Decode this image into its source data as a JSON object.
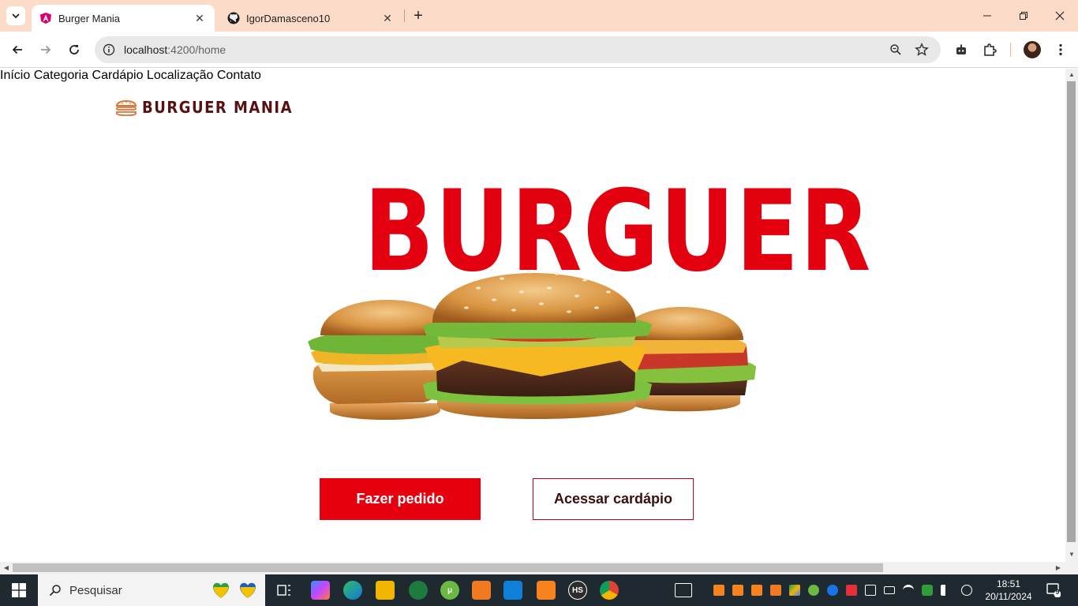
{
  "browser": {
    "tabs": [
      {
        "title": "Burger Mania",
        "active": true,
        "icon": "angular-icon"
      },
      {
        "title": "IgorDamasceno10",
        "active": false,
        "icon": "github-icon"
      }
    ],
    "url_host": "localhost",
    "url_path": ":4200/home"
  },
  "site": {
    "logo_text": "BURGUER MANIA",
    "nav": [
      "Início",
      "Categoria",
      "Cardápio",
      "Localização",
      "Contato"
    ],
    "hero_word": "BURGUER",
    "cta_primary": "Fazer pedido",
    "cta_secondary": "Acessar cardápio"
  },
  "taskbar": {
    "search_placeholder": "Pesquisar",
    "time": "18:51",
    "date": "20/11/2024",
    "notification_count": "9"
  },
  "colors": {
    "accent_red": "#e6000f",
    "brand_dark": "#4a0d0d",
    "tabstrip": "#fcdcc8"
  }
}
